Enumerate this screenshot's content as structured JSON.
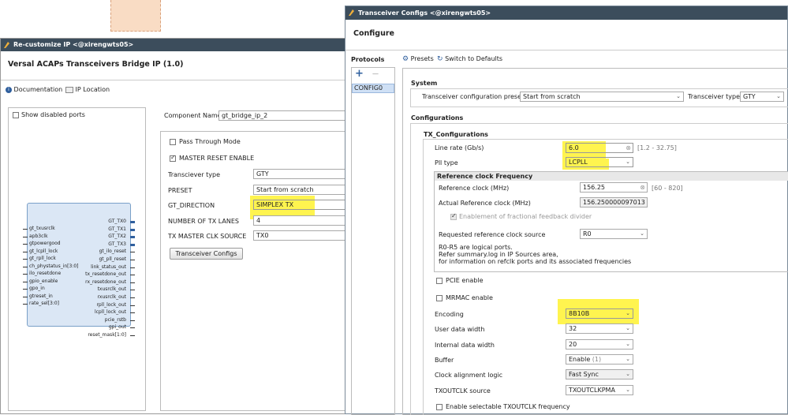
{
  "left_window": {
    "title": "Re-customize IP <@xirengwts05>",
    "header": "Versal ACAPs Transceivers Bridge IP (1.0)",
    "toolbar": {
      "documentation": "Documentation",
      "ip_location": "IP Location"
    },
    "show_disabled_ports": "Show disabled ports",
    "component_name_label": "Component Name",
    "component_name_value": "gt_bridge_ip_2",
    "pass_through_mode": "Pass Through Mode",
    "master_reset_enable": "MASTER RESET ENABLE",
    "form": [
      {
        "label": "Transciever type",
        "value": "GTY"
      },
      {
        "label": "PRESET",
        "value": "Start from scratch"
      },
      {
        "label": "GT_DIRECTION",
        "value": "SIMPLEX TX"
      },
      {
        "label": "NUMBER OF TX LANES",
        "value": "4"
      },
      {
        "label": "TX MASTER CLK SOURCE",
        "value": "TX0"
      }
    ],
    "transceiver_configs_button": "Transceiver Configs",
    "block": {
      "left_pins": [
        "gt_txusrclk",
        "apb3clk",
        "gtpowergood",
        "gt_lcpll_lock",
        "gt_rpll_lock",
        "ch_phystatus_in[3:0]",
        "ilo_resetdone",
        "gpio_enable",
        "gpo_in",
        "gtreset_in",
        "rate_sel[3:0]"
      ],
      "right_pins": [
        "GT_TX0",
        "GT_TX1",
        "GT_TX2",
        "GT_TX3",
        "gt_ilo_reset",
        "gt_pll_reset",
        "link_status_out",
        "tx_resetdone_out",
        "rx_resetdone_out",
        "txusrclk_out",
        "rxusrclk_out",
        "rpll_lock_out",
        "lcpll_lock_out",
        "pcie_rstb",
        "gpi_out",
        "reset_mask[1:0]"
      ]
    }
  },
  "right_window": {
    "title": "Transceiver Configs <@xirengwts05>",
    "header": "Configure",
    "protocols_label": "Protocols",
    "add_label": "+",
    "remove_label": "—",
    "protocol_item": "CONFIG0",
    "presets_label": "Presets",
    "switch_defaults_label": "Switch to Defaults",
    "system_heading": "System",
    "transceiver_preset_label": "Transceiver configuration preset",
    "transceiver_preset_value": "Start from scratch",
    "transceiver_type_label": "Transceiver type",
    "transceiver_type_value": "GTY",
    "configurations_heading": "Configurations",
    "tx_heading": "TX_Configurations",
    "line_rate_label": "Line rate (Gb/s)",
    "line_rate_value": "6.0",
    "line_rate_range": "[1.2 - 32.75]",
    "pll_type_label": "Pll type",
    "pll_type_value": "LCPLL",
    "ref_clock_heading": "Reference clock Frequency",
    "ref_clock_label": "Reference clock (MHz)",
    "ref_clock_value": "156.25",
    "ref_clock_range": "[60 - 820]",
    "actual_ref_label": "Actual Reference clock (MHz)",
    "actual_ref_value": "156.250000097013",
    "fractional_label": "Enablement of fractional feedback divider",
    "requested_ref_label": "Requested reference clock source",
    "requested_ref_value": "R0",
    "note_line1": "R0-R5 are logical ports.",
    "note_line2": "Refer summary.log in IP Sources area,",
    "note_line3": "for information on refclk ports and its associated frequencies",
    "pcie_enable": "PCIE enable",
    "mrmac_enable": "MRMAC enable",
    "encoding_label": "Encoding",
    "encoding_value": "8B10B",
    "user_width_label": "User data width",
    "user_width_value": "32",
    "internal_width_label": "Internal data width",
    "internal_width_value": "20",
    "buffer_label": "Buffer",
    "buffer_value": "Enable",
    "buffer_suffix": "(1)",
    "clock_align_label": "Clock alignment logic",
    "clock_align_value": "Fast Sync",
    "txoutclk_label": "TXOUTCLK source",
    "txoutclk_value": "TXOUTCLKPMA",
    "txoutclk_freq": "Enable selectable TXOUTCLK frequency"
  },
  "colors": {
    "title_bar": "#3c4d5c",
    "highlight": "#fff44f",
    "accent": "#2f5f9e"
  }
}
